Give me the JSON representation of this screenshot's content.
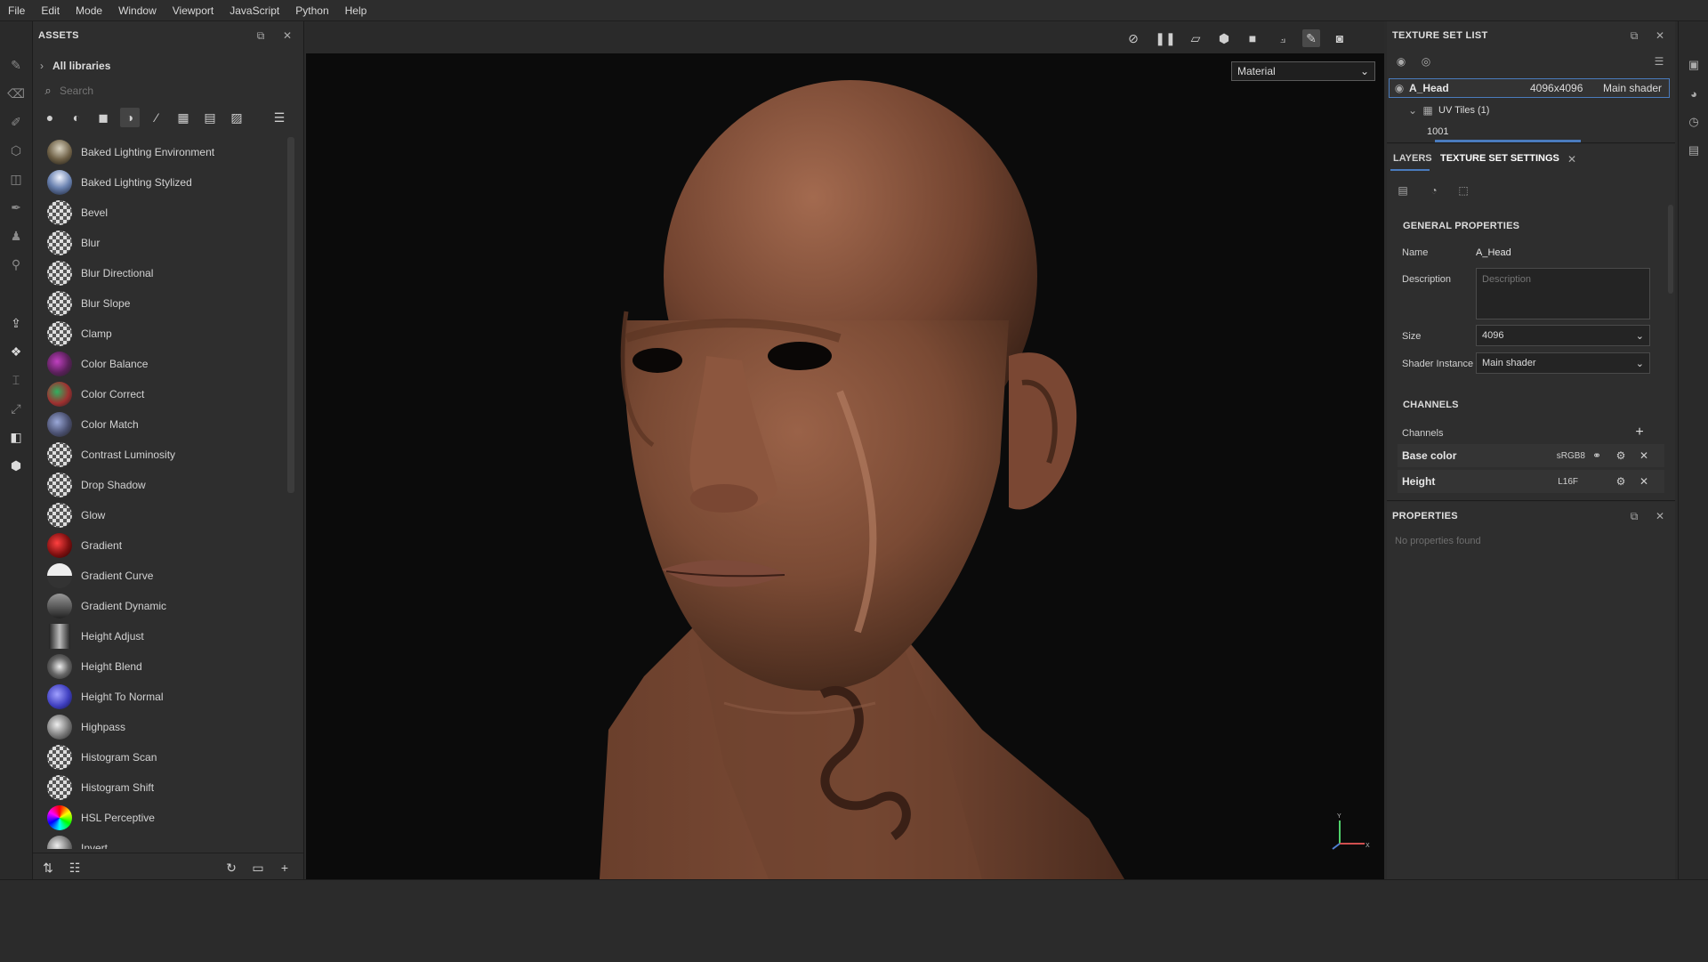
{
  "menu": [
    "File",
    "Edit",
    "Mode",
    "Window",
    "Viewport",
    "JavaScript",
    "Python",
    "Help"
  ],
  "assets": {
    "title": "ASSETS",
    "all_libraries": "All libraries",
    "search_placeholder": "Search",
    "items": [
      {
        "name": "Baked Lighting Environment",
        "thumb": "env1"
      },
      {
        "name": "Baked Lighting Stylized",
        "thumb": "env2"
      },
      {
        "name": "Bevel",
        "thumb": "checker"
      },
      {
        "name": "Blur",
        "thumb": "checker"
      },
      {
        "name": "Blur Directional",
        "thumb": "checker"
      },
      {
        "name": "Blur Slope",
        "thumb": "checker"
      },
      {
        "name": "Clamp",
        "thumb": "checker"
      },
      {
        "name": "Color Balance",
        "thumb": "cb"
      },
      {
        "name": "Color Correct",
        "thumb": "cc"
      },
      {
        "name": "Color Match",
        "thumb": "cm"
      },
      {
        "name": "Contrast Luminosity",
        "thumb": "checker"
      },
      {
        "name": "Drop Shadow",
        "thumb": "checker"
      },
      {
        "name": "Glow",
        "thumb": "checker"
      },
      {
        "name": "Gradient",
        "thumb": "grad"
      },
      {
        "name": "Gradient Curve",
        "thumb": "gc"
      },
      {
        "name": "Gradient Dynamic",
        "thumb": "gd"
      },
      {
        "name": "Height Adjust",
        "thumb": "ha"
      },
      {
        "name": "Height Blend",
        "thumb": "hb"
      },
      {
        "name": "Height To Normal",
        "thumb": "htn"
      },
      {
        "name": "Highpass",
        "thumb": "hp"
      },
      {
        "name": "Histogram Scan",
        "thumb": "checker"
      },
      {
        "name": "Histogram Shift",
        "thumb": "checker"
      },
      {
        "name": "HSL Perceptive",
        "thumb": "hsl"
      },
      {
        "name": "Invert",
        "thumb": "hp"
      }
    ]
  },
  "viewport": {
    "material_mode": "Material",
    "axis_y": "Y",
    "axis_x": "X"
  },
  "texture_set_list": {
    "title": "TEXTURE SET LIST",
    "set_name": "A_Head",
    "set_size": "4096x4096",
    "set_shader": "Main shader",
    "uv_tiles": "UV Tiles (1)",
    "tile": "1001"
  },
  "settings": {
    "tab_layers": "LAYERS",
    "tab_tss": "TEXTURE SET SETTINGS",
    "general": "GENERAL PROPERTIES",
    "name_label": "Name",
    "name_value": "A_Head",
    "desc_label": "Description",
    "desc_placeholder": "Description",
    "size_label": "Size",
    "size_value": "4096",
    "shader_label": "Shader Instance",
    "shader_value": "Main shader",
    "channels_section": "CHANNELS",
    "channels_label": "Channels",
    "channels": [
      {
        "name": "Base color",
        "format": "sRGB8"
      },
      {
        "name": "Height",
        "format": "L16F"
      }
    ]
  },
  "properties": {
    "title": "PROPERTIES",
    "empty": "No properties found"
  },
  "colors": {
    "accent": "#4a7bbd",
    "background": "#2b2b2b"
  }
}
